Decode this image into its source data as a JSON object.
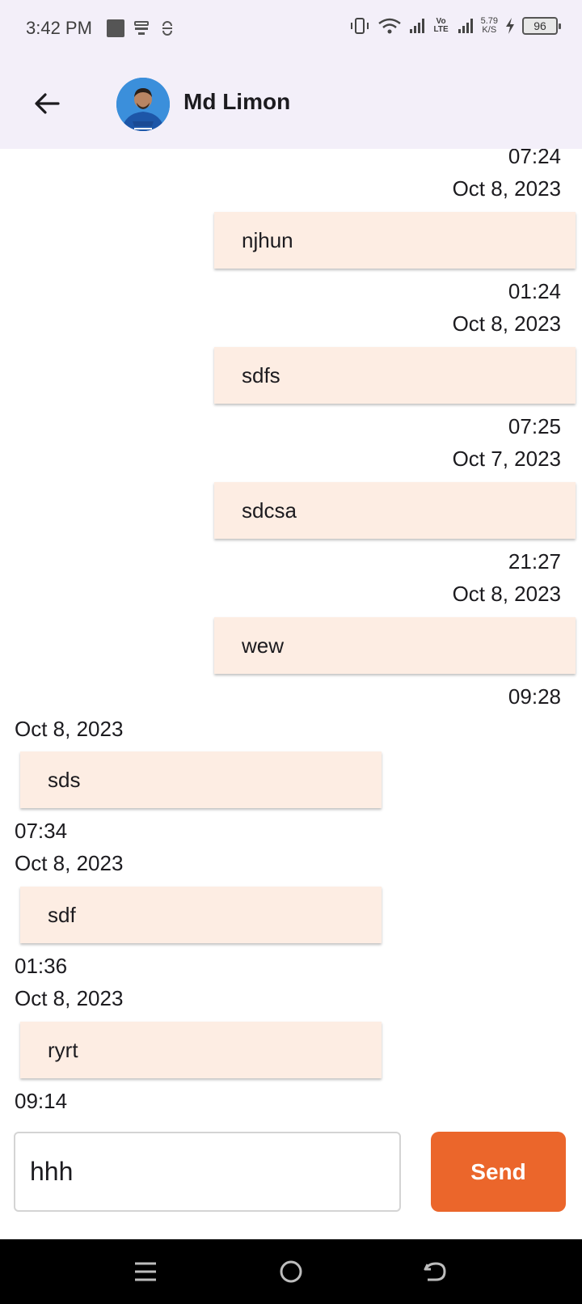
{
  "status_bar": {
    "time": "3:42 PM",
    "network_badge": "Vo LTE",
    "speed_value": "5.79",
    "speed_unit": "K/S",
    "battery": "96"
  },
  "header": {
    "title": "Md Limon",
    "back_icon": "arrow-left-icon",
    "avatar": "profile-photo"
  },
  "messages": [
    {
      "side": "right",
      "time_above": "07:24",
      "date": "Oct 8, 2023",
      "text": "njhun"
    },
    {
      "side": "right",
      "time_above": "01:24",
      "date": "Oct 8, 2023",
      "text": "sdfs"
    },
    {
      "side": "right",
      "time_above": "07:25",
      "date": "Oct 7, 2023",
      "text": "sdcsa"
    },
    {
      "side": "right",
      "time_above": "21:27",
      "date": "Oct 8, 2023",
      "text": "wew"
    },
    {
      "side": "right",
      "time_above": "09:28"
    },
    {
      "side": "left",
      "date": "Oct 8, 2023",
      "text": "sds",
      "time_below": "07:34"
    },
    {
      "side": "left",
      "date": "Oct 8, 2023",
      "text": "sdf",
      "time_below": "01:36"
    },
    {
      "side": "left",
      "date": "Oct 8, 2023",
      "text": "ryrt",
      "time_below": "09:14"
    }
  ],
  "composer": {
    "value": "hhh",
    "send_label": "Send"
  },
  "colors": {
    "app_bar_bg": "#f3eff9",
    "bubble_bg": "#fdede3",
    "send_button": "#eb662b"
  },
  "nav_bar": {
    "menu_icon": "menu-icon",
    "home_icon": "home-circle-icon",
    "back_icon": "back-gesture-icon"
  }
}
